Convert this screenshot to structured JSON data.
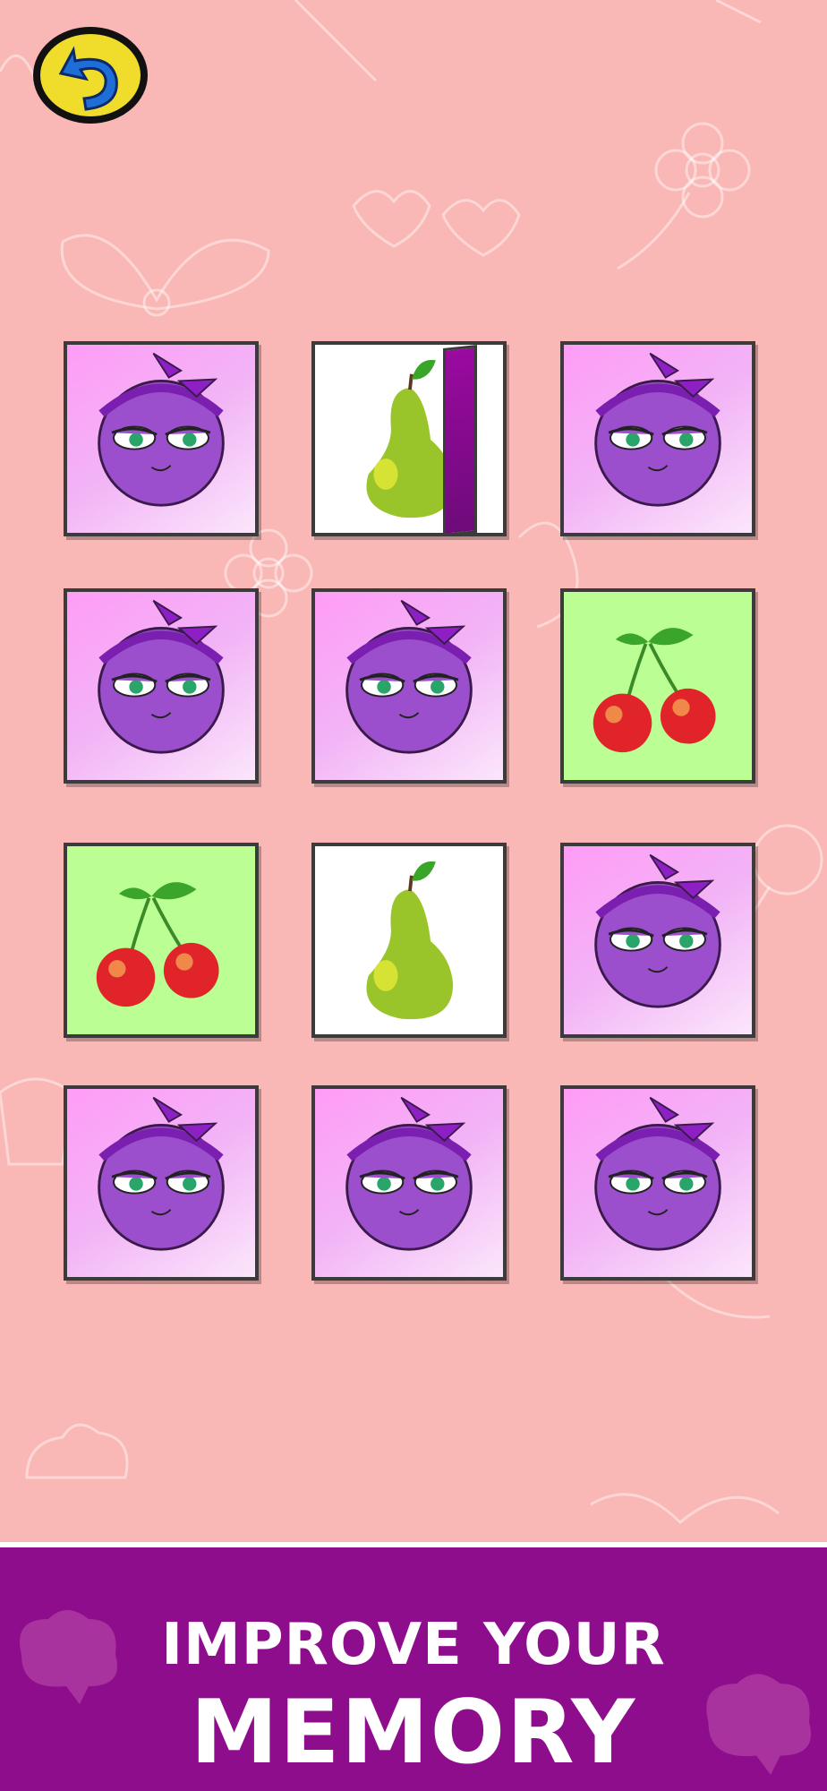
{
  "game": {
    "back_button_icon": "undo-arrow-icon",
    "grid": [
      [
        "back",
        "pear",
        "back"
      ],
      [
        "back",
        "back",
        "cherry"
      ],
      [
        "cherry",
        "pear",
        "back"
      ],
      [
        "back",
        "back",
        "back"
      ]
    ],
    "colors": {
      "background": "#f9b7b5",
      "card_back": "#f2b4f6",
      "cherry_card": "#bbff94",
      "pear_card": "#ffffff",
      "banner": "#8e0d8c"
    }
  },
  "banner": {
    "line1": "IMPROVE YOUR",
    "line2": "MEMORY"
  }
}
